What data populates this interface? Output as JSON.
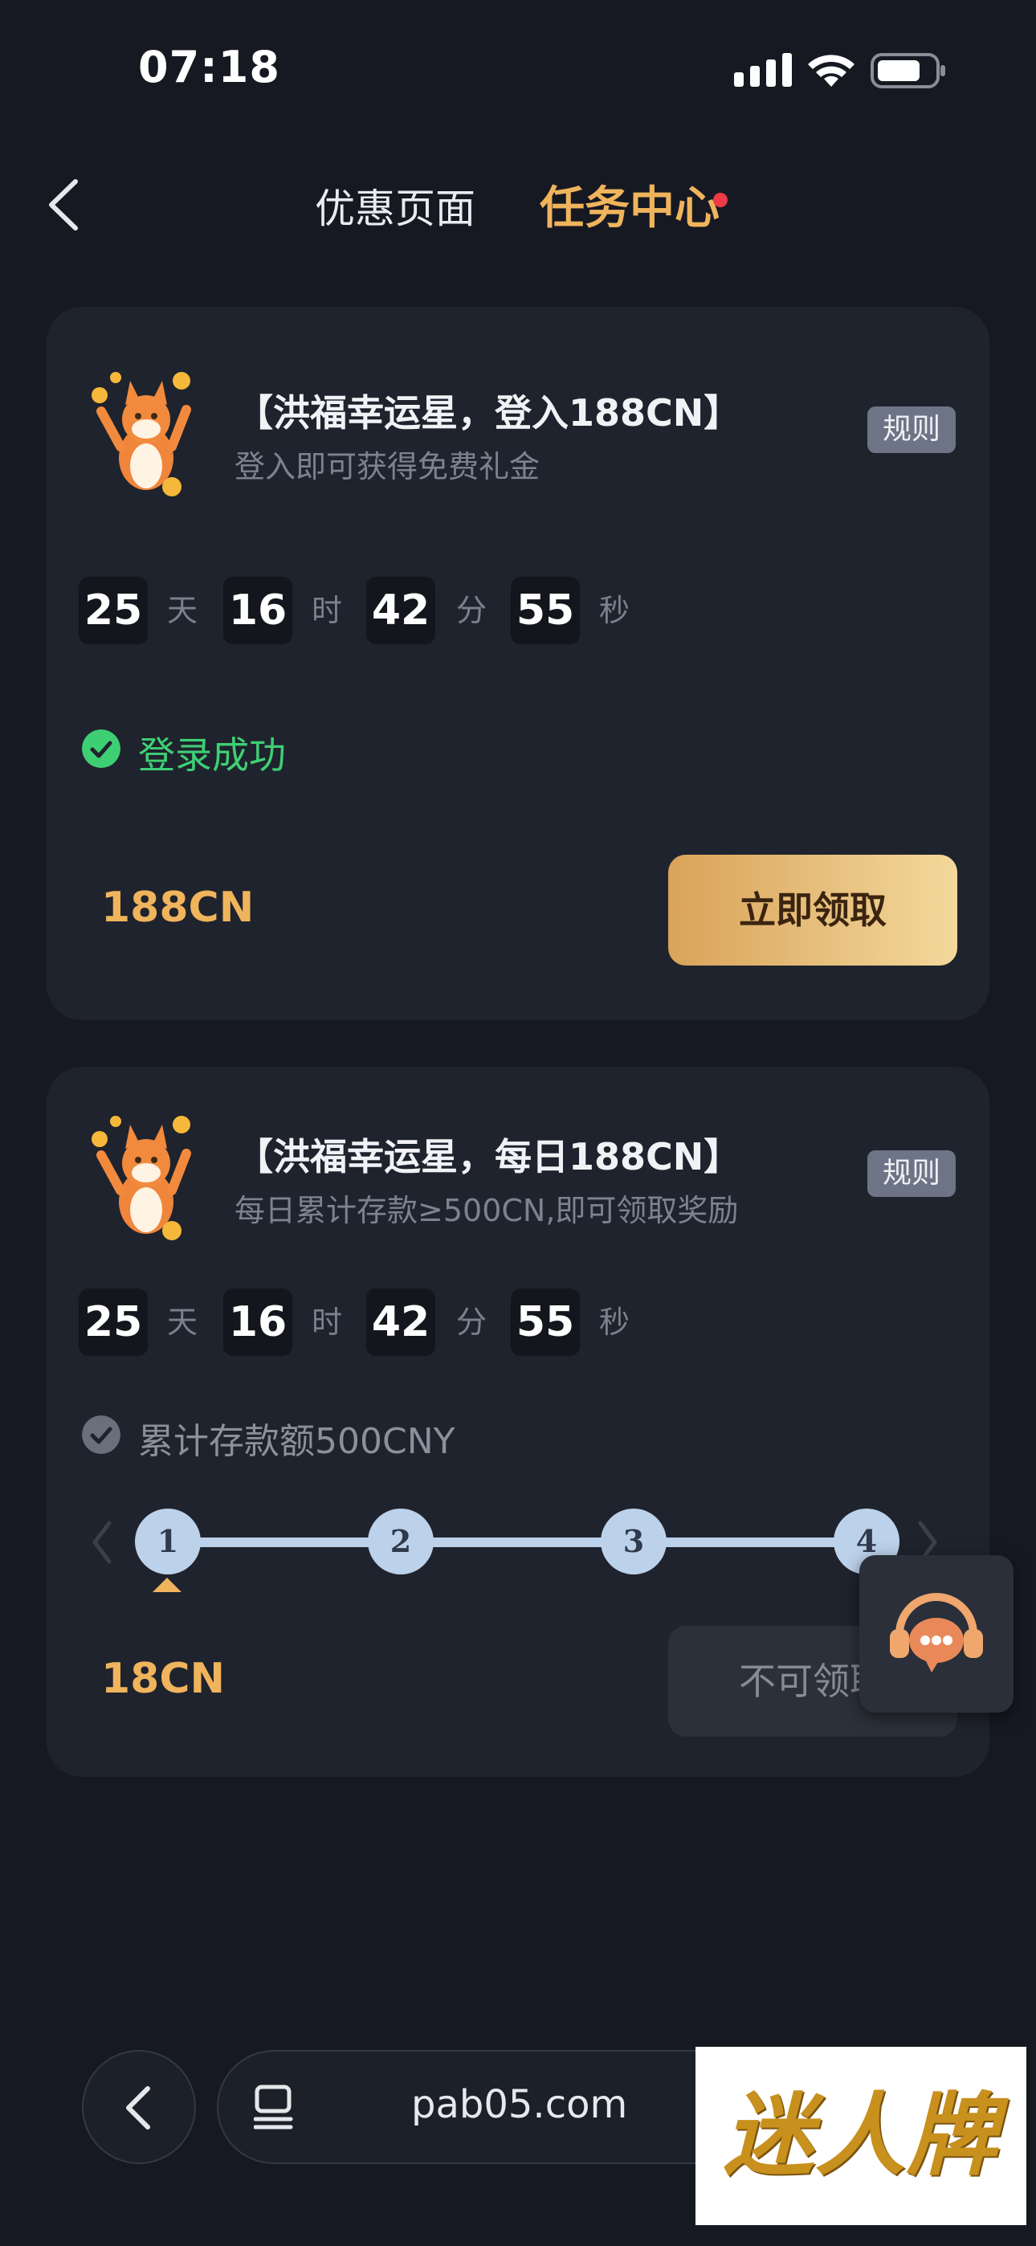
{
  "status_bar": {
    "time": "07:18"
  },
  "header": {
    "tabs": [
      {
        "label": "优惠页面",
        "active": false
      },
      {
        "label": "任务中心",
        "active": true
      }
    ]
  },
  "tasks": [
    {
      "title": "【洪福幸运星，登入188CN】",
      "subtitle": "登入即可获得免费礼金",
      "rule_label": "规则",
      "countdown": [
        {
          "value": "25",
          "unit": "天"
        },
        {
          "value": "16",
          "unit": "时"
        },
        {
          "value": "42",
          "unit": "分"
        },
        {
          "value": "55",
          "unit": "秒"
        }
      ],
      "status": "登录成功",
      "reward": "188CN",
      "button": "立即领取"
    },
    {
      "title": "【洪福幸运星，每日188CN】",
      "subtitle": "每日累计存款≥500CN,即可领取奖励",
      "rule_label": "规则",
      "countdown": [
        {
          "value": "25",
          "unit": "天"
        },
        {
          "value": "16",
          "unit": "时"
        },
        {
          "value": "42",
          "unit": "分"
        },
        {
          "value": "55",
          "unit": "秒"
        }
      ],
      "status": "累计存款额500CNY",
      "steps": [
        "1",
        "2",
        "3",
        "4"
      ],
      "current_step": 1,
      "reward": "18CN",
      "button": "不可领取"
    }
  ],
  "browser": {
    "url": "pab05.com"
  },
  "watermark": "迷人牌",
  "colors": {
    "accent": "#efb45c",
    "success": "#3ecf74",
    "background": "#161922",
    "card": "#1f232d"
  }
}
